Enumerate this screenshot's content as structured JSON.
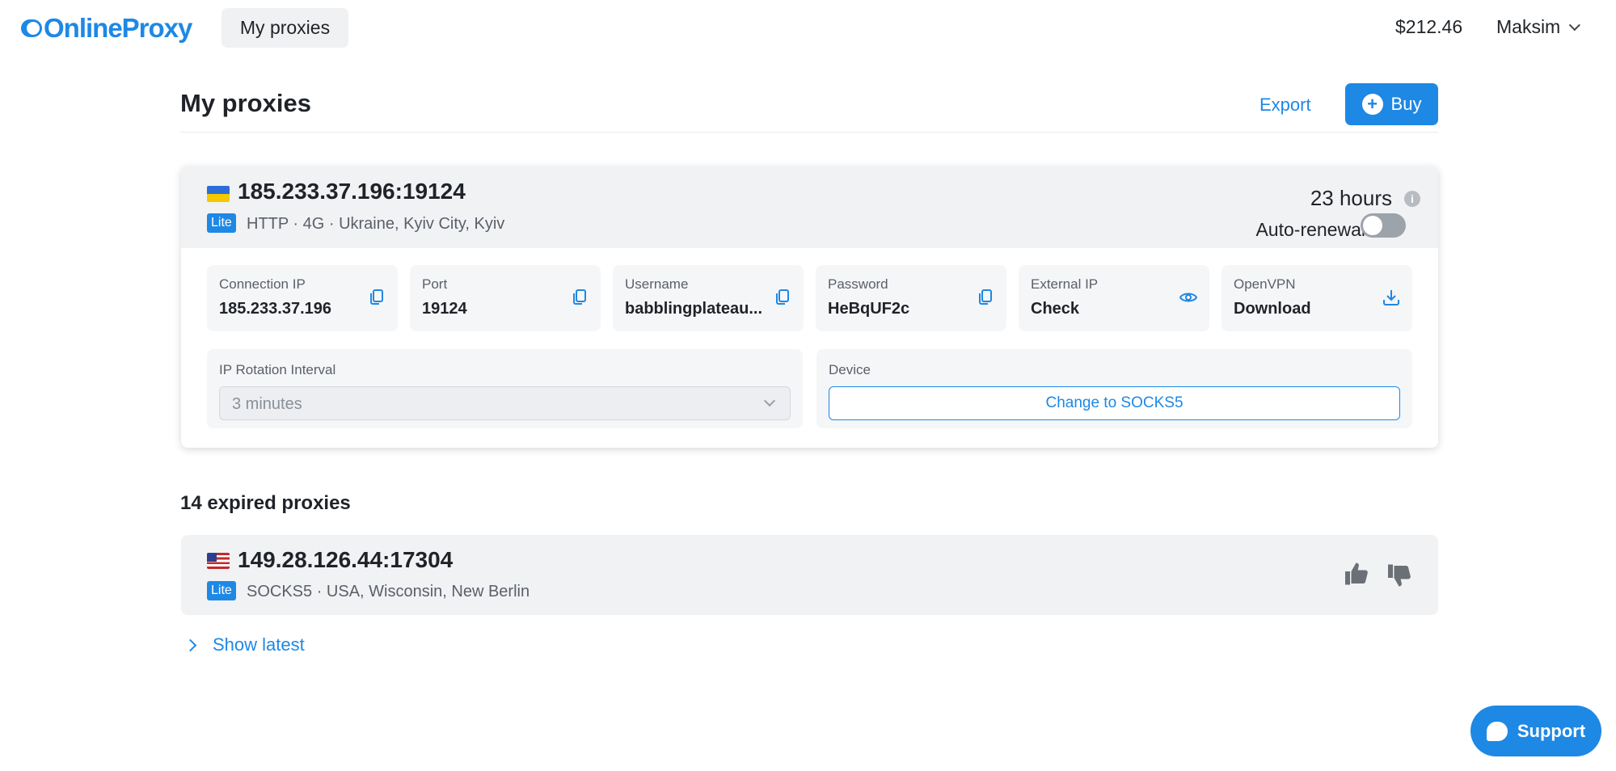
{
  "header": {
    "logo_text": "OnlineProxy",
    "nav_active": "My proxies",
    "balance": "$212.46",
    "user_name": "Maksim"
  },
  "page": {
    "title": "My proxies",
    "export_label": "Export",
    "buy_label": "Buy"
  },
  "active_proxy": {
    "address": "185.233.37.196:19124",
    "badge": "Lite",
    "meta": "HTTP · 4G · Ukraine, Kyiv City, Kyiv",
    "time_left": "23 hours",
    "auto_renewal_label": "Auto-renewal",
    "auto_renewal_on": false,
    "fields": [
      {
        "label": "Connection IP",
        "value": "185.233.37.196",
        "icon": "copy-icon"
      },
      {
        "label": "Port",
        "value": "19124",
        "icon": "copy-icon"
      },
      {
        "label": "Username",
        "value": "babblingplateau...",
        "icon": "copy-icon"
      },
      {
        "label": "Password",
        "value": "HeBqUF2c",
        "icon": "copy-icon"
      },
      {
        "label": "External IP",
        "value": "Check",
        "icon": "eye-icon"
      },
      {
        "label": "OpenVPN",
        "value": "Download",
        "icon": "download-icon"
      }
    ],
    "rotation": {
      "label": "IP Rotation Interval",
      "value": "3 minutes"
    },
    "device": {
      "label": "Device",
      "button_label": "Change to SOCKS5"
    }
  },
  "expired": {
    "title": "14 expired proxies",
    "items": [
      {
        "address": "149.28.126.44:17304",
        "badge": "Lite",
        "meta": "SOCKS5 · USA, Wisconsin, New Berlin"
      }
    ],
    "show_latest_label": "Show latest"
  },
  "support": {
    "label": "Support"
  },
  "colors": {
    "accent": "#1e88e5",
    "card_header_bg": "#f1f2f4",
    "field_bg": "#f5f6f8"
  }
}
